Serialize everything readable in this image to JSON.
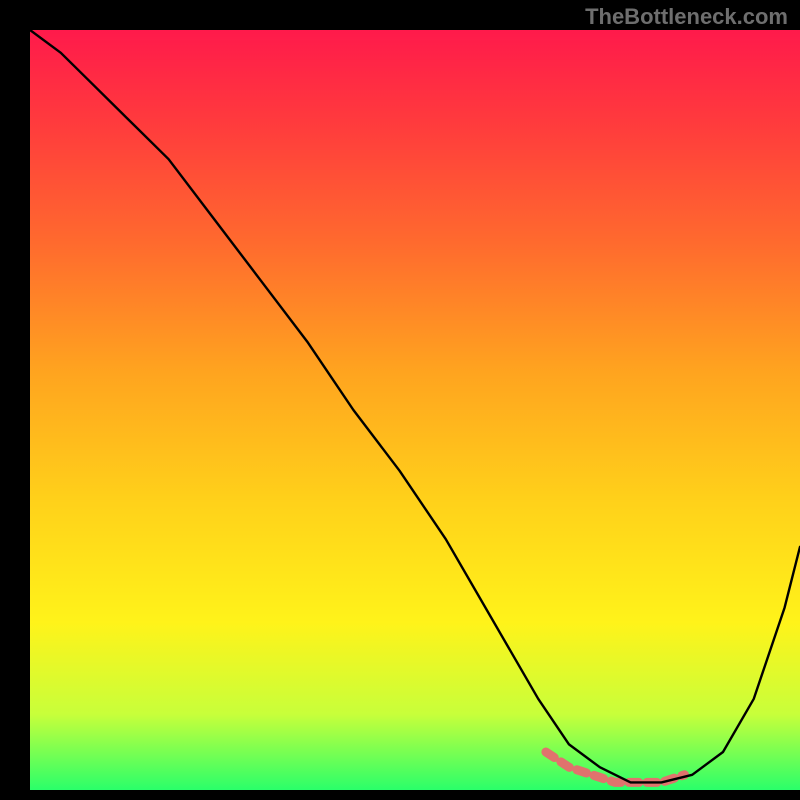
{
  "watermark": "TheBottleneck.com",
  "chart_data": {
    "type": "line",
    "title": "",
    "xlabel": "",
    "ylabel": "",
    "xlim": [
      0,
      100
    ],
    "ylim": [
      0,
      100
    ],
    "grid": false,
    "series": [
      {
        "name": "curve",
        "x": [
          0,
          4,
          8,
          12,
          18,
          24,
          30,
          36,
          42,
          48,
          54,
          58,
          62,
          66,
          70,
          74,
          78,
          82,
          86,
          90,
          94,
          98,
          100
        ],
        "y": [
          100,
          97,
          93,
          89,
          83,
          75,
          67,
          59,
          50,
          42,
          33,
          26,
          19,
          12,
          6,
          3,
          1,
          1,
          2,
          5,
          12,
          24,
          32
        ]
      },
      {
        "name": "highlight-band",
        "x": [
          67,
          70,
          73,
          76,
          79,
          82,
          85
        ],
        "y": [
          5,
          3,
          2,
          1,
          1,
          1,
          2
        ]
      }
    ],
    "background_gradient": {
      "stops": [
        {
          "pos": 0.0,
          "color": "#ff1a4b"
        },
        {
          "pos": 0.12,
          "color": "#ff3a3d"
        },
        {
          "pos": 0.28,
          "color": "#ff6a2e"
        },
        {
          "pos": 0.45,
          "color": "#ffa41f"
        },
        {
          "pos": 0.62,
          "color": "#ffd11a"
        },
        {
          "pos": 0.78,
          "color": "#fff31a"
        },
        {
          "pos": 0.9,
          "color": "#c8ff3a"
        },
        {
          "pos": 1.0,
          "color": "#2aff6a"
        }
      ]
    }
  }
}
